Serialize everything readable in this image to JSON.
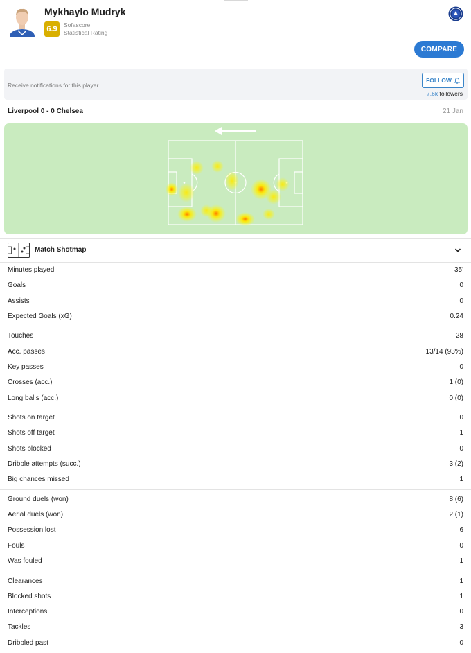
{
  "player": {
    "name": "Mykhaylo Mudryk",
    "rating": "6.9",
    "rating_source": "Sofascore",
    "rating_label": "Statistical Rating"
  },
  "actions": {
    "compare_label": "COMPARE",
    "follow_label": "FOLLOW"
  },
  "notifications": {
    "text": "Receive notifications for this player",
    "followers_count": "7.6k",
    "followers_label": "followers"
  },
  "match": {
    "title": "Liverpool 0 - 0 Chelsea",
    "date": "21 Jan"
  },
  "shotmap": {
    "label": "Match Shotmap"
  },
  "colors": {
    "accent": "#2c7ad3",
    "rating_badge": "#d9af00",
    "pitch": "#c9ebbf"
  },
  "stat_groups": [
    [
      {
        "label": "Minutes played",
        "value": "35'"
      },
      {
        "label": "Goals",
        "value": "0"
      },
      {
        "label": "Assists",
        "value": "0"
      },
      {
        "label": "Expected Goals (xG)",
        "value": "0.24"
      }
    ],
    [
      {
        "label": "Touches",
        "value": "28"
      },
      {
        "label": "Acc. passes",
        "value": "13/14 (93%)"
      },
      {
        "label": "Key passes",
        "value": "0"
      },
      {
        "label": "Crosses (acc.)",
        "value": "1 (0)"
      },
      {
        "label": "Long balls (acc.)",
        "value": "0 (0)"
      }
    ],
    [
      {
        "label": "Shots on target",
        "value": "0"
      },
      {
        "label": "Shots off target",
        "value": "1"
      },
      {
        "label": "Shots blocked",
        "value": "0"
      },
      {
        "label": "Dribble attempts (succ.)",
        "value": "3 (2)"
      },
      {
        "label": "Big chances missed",
        "value": "1"
      }
    ],
    [
      {
        "label": "Ground duels (won)",
        "value": "8 (6)"
      },
      {
        "label": "Aerial duels (won)",
        "value": "2 (1)"
      },
      {
        "label": "Possession lost",
        "value": "6"
      },
      {
        "label": "Fouls",
        "value": "0"
      },
      {
        "label": "Was fouled",
        "value": "1"
      }
    ],
    [
      {
        "label": "Clearances",
        "value": "1"
      },
      {
        "label": "Blocked shots",
        "value": "1"
      },
      {
        "label": "Interceptions",
        "value": "0"
      },
      {
        "label": "Tackles",
        "value": "3"
      },
      {
        "label": "Dribbled past",
        "value": "0"
      }
    ]
  ]
}
